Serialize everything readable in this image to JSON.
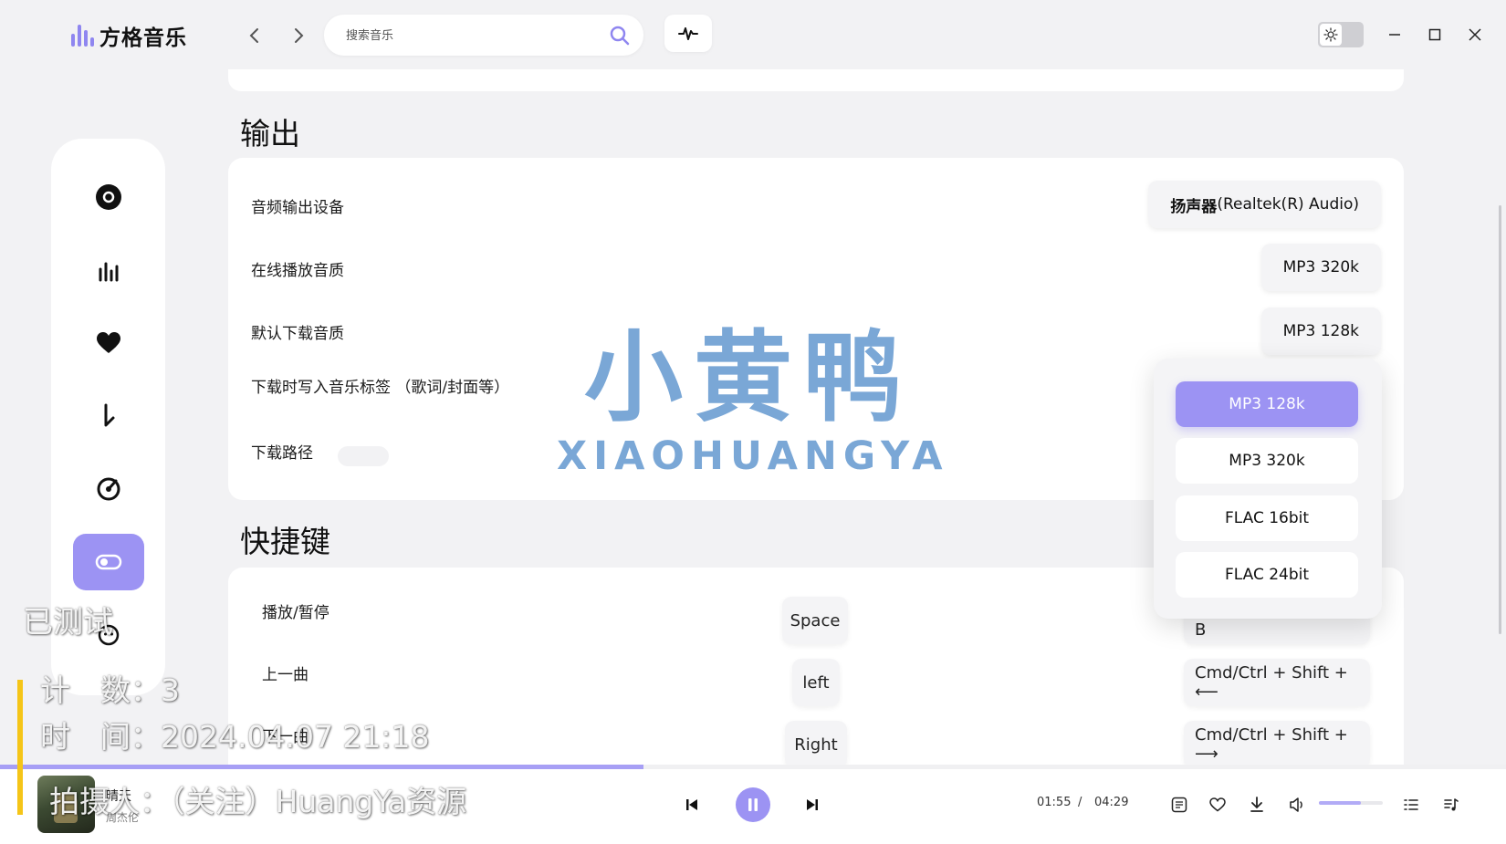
{
  "app": {
    "title": "方格音乐"
  },
  "search": {
    "placeholder": "搜索音乐"
  },
  "sections": {
    "output_title": "输出",
    "shortcuts_title": "快捷键"
  },
  "output": {
    "rows": [
      {
        "label": "音频输出设备",
        "value_bold": "扬声器",
        "value_rest": " (Realtek(R) Audio)"
      },
      {
        "label": "在线播放音质",
        "value": "MP3 320k"
      },
      {
        "label": "默认下载音质",
        "value": "MP3 128k"
      },
      {
        "label": "下载时写入音乐标签 （歌词/封面等）"
      },
      {
        "label": "下载路径"
      }
    ]
  },
  "quality_dropdown": {
    "options": [
      "MP3 128k",
      "MP3 320k",
      "FLAC 16bit",
      "FLAC 24bit"
    ],
    "selected": "MP3 128k"
  },
  "shortcuts": [
    {
      "action": "播放/暂停",
      "key": "Space",
      "global": "Cmd/Ctrl + Shift + B"
    },
    {
      "action": "上一曲",
      "key": "left",
      "global": "Cmd/Ctrl + Shift + ⟵"
    },
    {
      "action": "下一曲",
      "key": "Right",
      "global": "Cmd/Ctrl + Shift + ⟶"
    }
  ],
  "player": {
    "song_title": "晴天",
    "artist": "周杰伦",
    "current_time": "01:55",
    "separator": "/",
    "total_time": "04:29",
    "progress": 0.427,
    "volume": 0.65
  },
  "watermark": {
    "cn": "小黄鸭",
    "en": "XIAOHUANGYA"
  },
  "overlay": {
    "tested": "已测试",
    "count": "计　数：3",
    "time": "时　间：2024.04.07 21:18",
    "shot_by": "拍摄人：（关注）HuangYa资源"
  },
  "colors": {
    "accent": "#9c93f3",
    "background": "#f2f2f4",
    "card": "#ffffff"
  },
  "icons": {
    "sidebar": [
      "record-icon",
      "chart-bars-icon",
      "heart-icon",
      "download-icon",
      "target-icon",
      "toggle-icon",
      "face-icon"
    ]
  }
}
